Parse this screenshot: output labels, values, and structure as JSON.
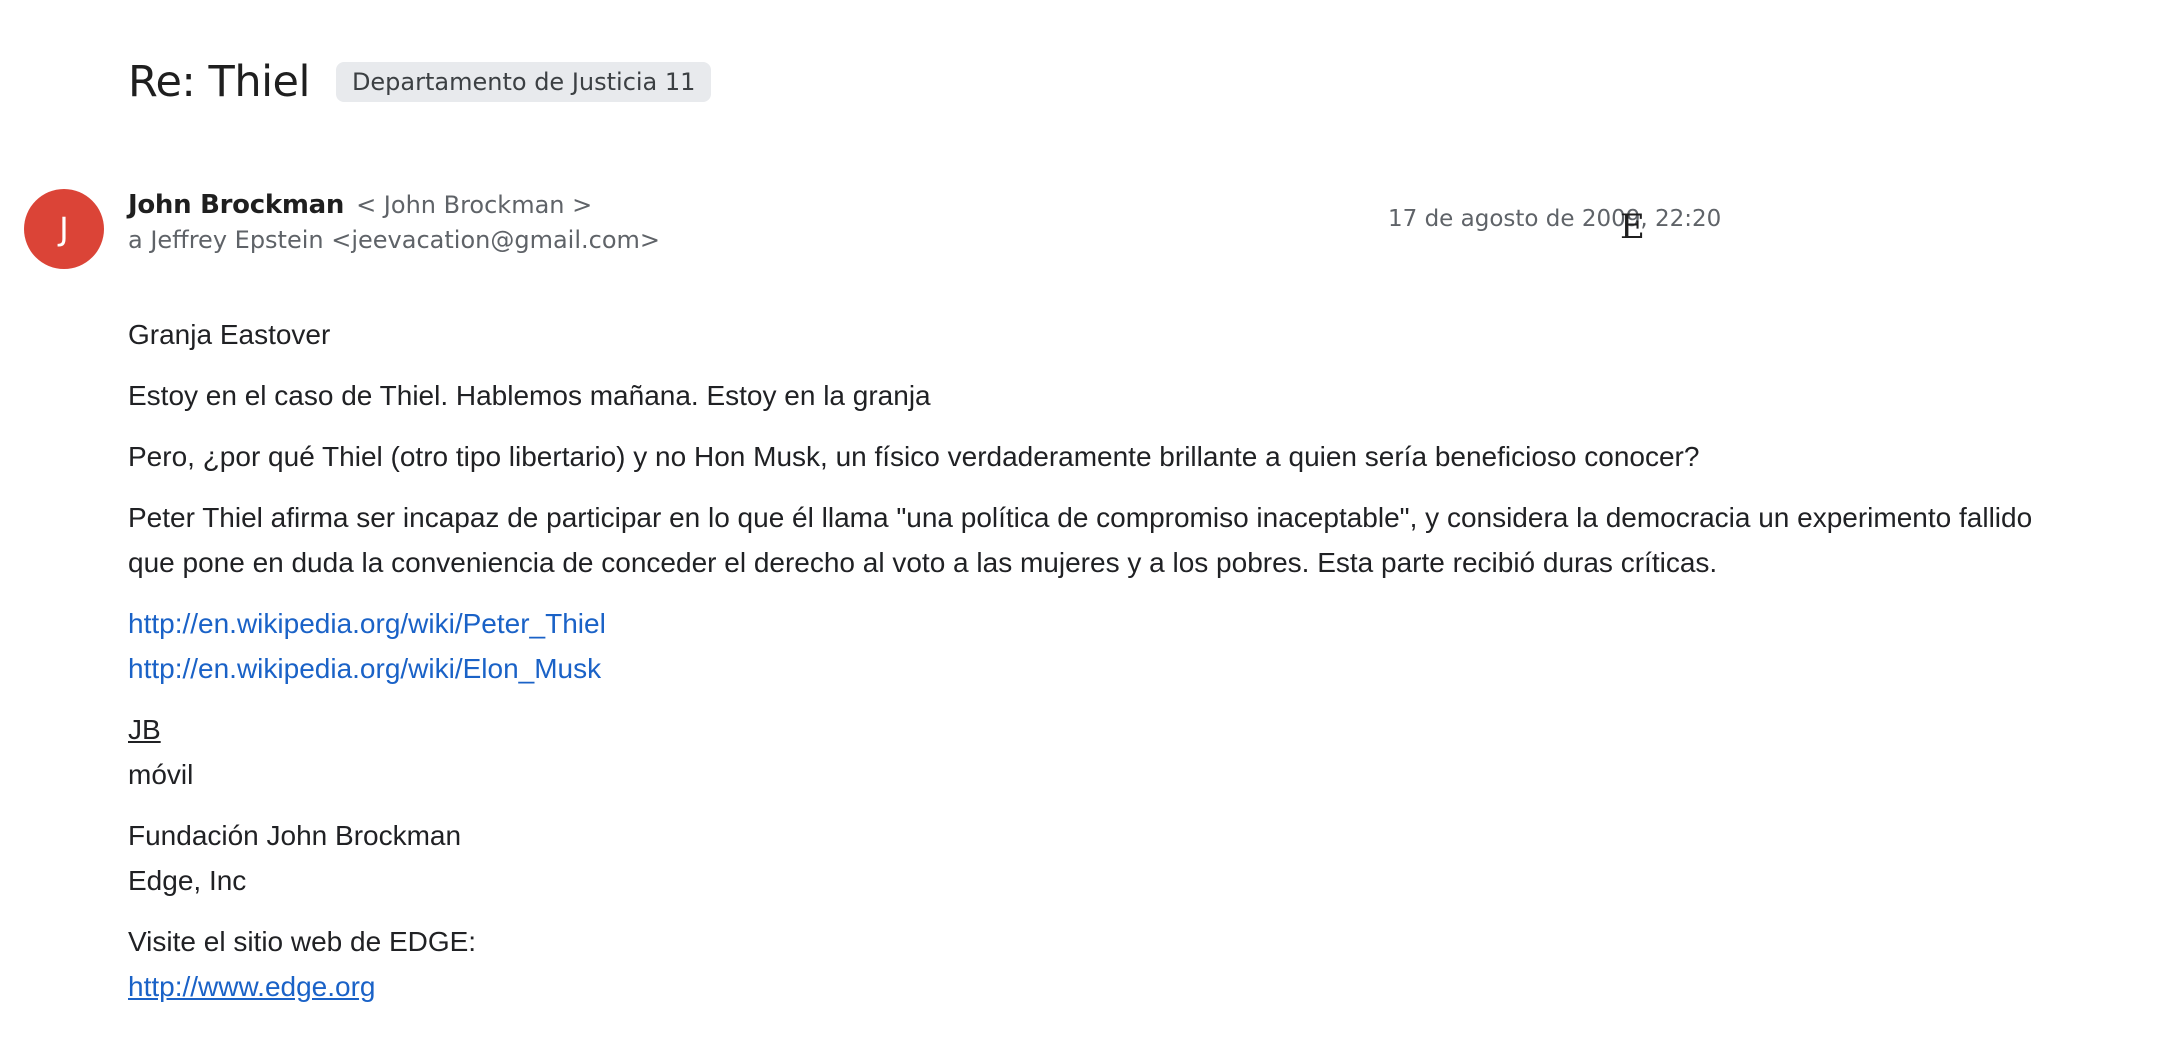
{
  "email": {
    "subject": "Re: Thiel",
    "label": "Departamento de Justicia 11",
    "avatar_letter": "J",
    "avatar_color": "#db4437",
    "sender_name": "John Brockman",
    "sender_email": "< John Brockman >",
    "recipient": "a Jeffrey Epstein <jeevacation@gmail.com>",
    "date": "17 de agosto de 2009, 22:20",
    "stray_glyph": "E"
  },
  "body": {
    "line1": "Granja Eastover",
    "line2": "Estoy en el caso de Thiel. Hablemos mañana. Estoy en la granja",
    "line3": "Pero, ¿por qué Thiel (otro tipo libertario) y no Hon Musk, un físico verdaderamente brillante a quien sería beneficioso conocer?",
    "line4": "Peter Thiel afirma ser incapaz de participar en lo que él llama \"una política de compromiso inaceptable\", y considera la democracia un experimento fallido que pone en duda la conveniencia de conceder el derecho al voto a las mujeres y a los pobres. Esta parte recibió duras críticas.",
    "link1": "http://en.wikipedia.org/wiki/Peter_Thiel",
    "link2": "http://en.wikipedia.org/wiki/Elon_Musk",
    "signature_initials": "JB",
    "signature_mobile": "móvil",
    "org1": "Fundación John Brockman",
    "org2": "Edge, Inc",
    "visit_text": "Visite el sitio web de EDGE:",
    "edge_link": "http://www.edge.org"
  },
  "colors": {
    "link": "#1a62c7",
    "chip_background": "#e8eaed",
    "secondary_text": "#5f6368"
  }
}
